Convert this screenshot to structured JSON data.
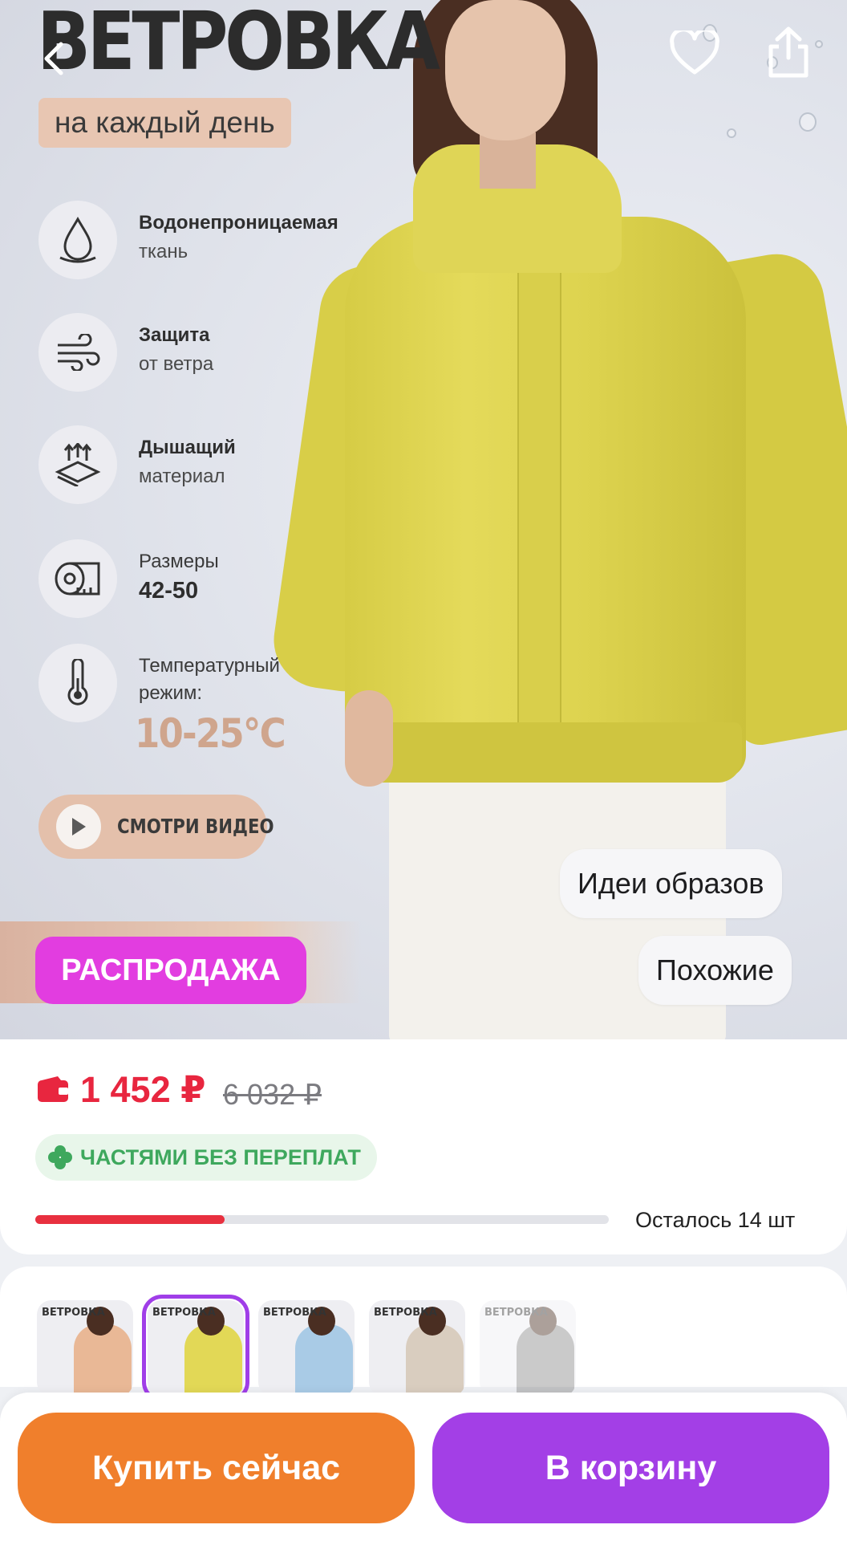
{
  "banner": {
    "title": "ВЕТРОВКА",
    "subtitle": "на каждый день",
    "features": [
      {
        "line1": "Водонепроницаемая",
        "line2": "ткань",
        "icon": "water-drop-icon"
      },
      {
        "line1": "Защита",
        "line2": "от ветра",
        "icon": "wind-icon"
      },
      {
        "line1": "Дышащий",
        "line2": "материал",
        "icon": "breathable-layers-icon"
      },
      {
        "line1": "Размеры",
        "line2": "42-50",
        "icon": "measuring-tape-icon"
      },
      {
        "line1": "Температурный",
        "line2": "режим:",
        "value": "10-25°C",
        "icon": "thermometer-icon"
      }
    ],
    "video_button": "СМОТРИ ВИДЕО"
  },
  "badges": {
    "sale": "РАСПРОДАЖА"
  },
  "chips": {
    "ideas": "Идеи образов",
    "similar": "Похожие"
  },
  "price": {
    "current": "1 452 ₽",
    "old": "6 032 ₽",
    "installments": "ЧАСТЯМИ БЕЗ ПЕРЕПЛАТ"
  },
  "stock": {
    "label": "Осталось 14 шт",
    "fill_fraction": 0.33
  },
  "thumbnails": [
    {
      "title": "ВЕТРОВКА",
      "color": "#e9b896",
      "selected": false
    },
    {
      "title": "ВЕТРОВКА",
      "color": "#e2d856",
      "selected": true
    },
    {
      "title": "ВЕТРОВКА",
      "color": "#a9cbe6",
      "selected": false
    },
    {
      "title": "ВЕТРОВКА",
      "color": "#d9cdbf",
      "selected": false
    },
    {
      "title": "ВЕТРОВКА",
      "color": "#8c8c8c",
      "selected": false
    }
  ],
  "actions": {
    "buy_now": "Купить сейчас",
    "to_cart": "В корзину"
  },
  "colors": {
    "price": "#e8263f",
    "sale": "#e23de0",
    "buy_now": "#f07f2c",
    "to_cart": "#a33fe6",
    "installments": "#3ea85d"
  }
}
